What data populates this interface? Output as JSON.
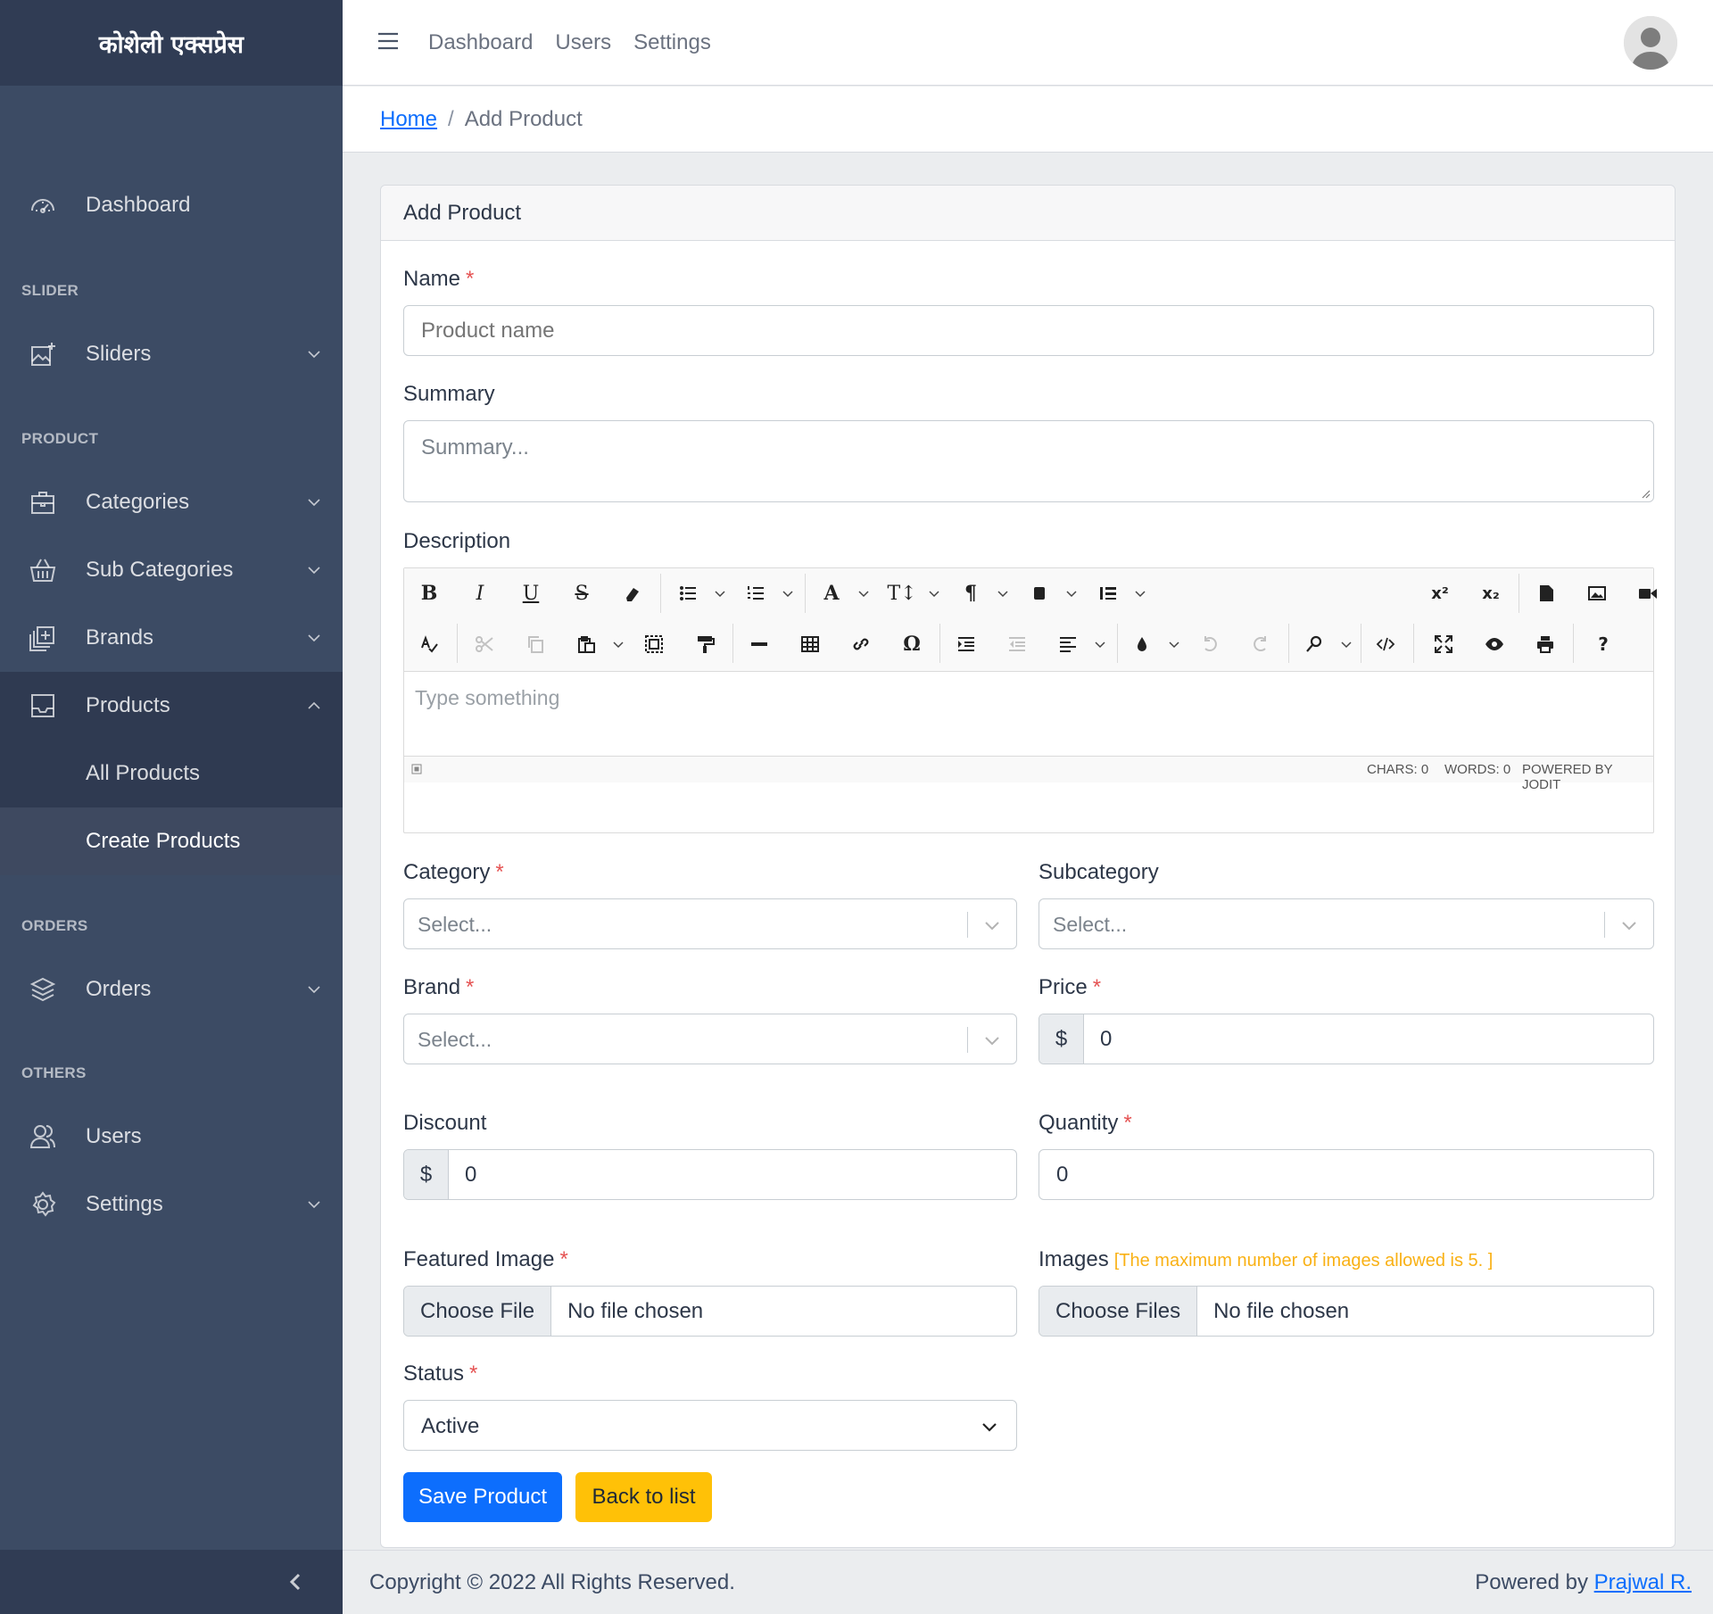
{
  "sidebar": {
    "brand": "कोशेली एक्सप्रेस",
    "dashboard": "Dashboard",
    "sections": {
      "slider": "SLIDER",
      "product": "PRODUCT",
      "orders": "ORDERS",
      "others": "OTHERS"
    },
    "items": {
      "sliders": "Sliders",
      "categories": "Categories",
      "sub_categories": "Sub Categories",
      "brands": "Brands",
      "products": "Products",
      "all_products": "All Products",
      "create_products": "Create Products",
      "orders": "Orders",
      "users": "Users",
      "settings": "Settings"
    }
  },
  "header": {
    "links": [
      "Dashboard",
      "Users",
      "Settings"
    ]
  },
  "breadcrumb": {
    "home": "Home",
    "separator": "/",
    "current": "Add Product"
  },
  "form": {
    "title": "Add Product",
    "required_mark": "*",
    "name": {
      "label": "Name",
      "placeholder": "Product name"
    },
    "summary": {
      "label": "Summary",
      "placeholder": "Summary..."
    },
    "description": {
      "label": "Description",
      "placeholder": "Type something",
      "chars": "CHARS: 0",
      "words": "WORDS: 0",
      "powered": "POWERED BY JODIT"
    },
    "category": {
      "label": "Category",
      "value": "Select..."
    },
    "subcategory": {
      "label": "Subcategory",
      "value": "Select..."
    },
    "brand": {
      "label": "Brand",
      "value": "Select..."
    },
    "price": {
      "label": "Price",
      "prefix": "$",
      "value": "0"
    },
    "discount": {
      "label": "Discount",
      "prefix": "$",
      "value": "0"
    },
    "quantity": {
      "label": "Quantity",
      "value": "0"
    },
    "featured_image": {
      "label": "Featured Image",
      "button": "Choose File",
      "text": "No file chosen"
    },
    "images": {
      "label": "Images",
      "note": "[The maximum number of images allowed is 5. ]",
      "button": "Choose Files",
      "text": "No file chosen"
    },
    "status": {
      "label": "Status",
      "value": "Active"
    },
    "save_button": "Save Product",
    "back_button": "Back to list"
  },
  "editor_toolbar": {
    "superscript": "x²",
    "subscript": "x₂",
    "omega": "Ω",
    "help": "?"
  },
  "footer": {
    "copyright": "Copyright © 2022 All Rights Reserved.",
    "powered_by": "Powered by",
    "author": "Prajwal R."
  },
  "colors": {
    "sidebar": "#3c4b64",
    "primary": "#0d6efd",
    "warning": "#ffc107",
    "required": "#e55353"
  }
}
